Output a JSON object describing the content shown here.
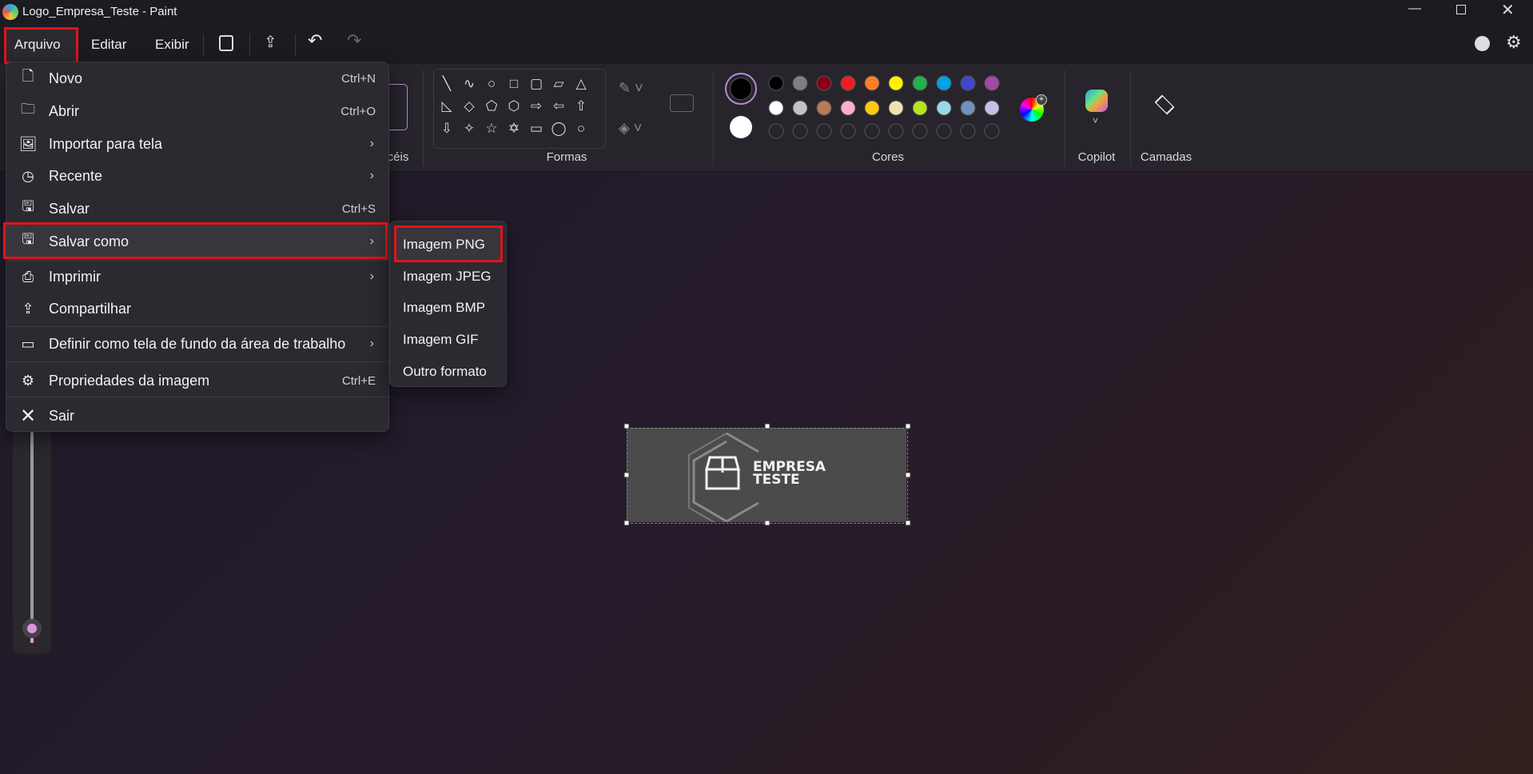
{
  "window": {
    "title": "Logo_Empresa_Teste - Paint"
  },
  "menubar": {
    "items": [
      "Arquivo",
      "Editar",
      "Exibir"
    ]
  },
  "ribbon": {
    "brushes_label_partial": "céis",
    "shapes_label": "Formas",
    "colors_label": "Cores",
    "copilot_label": "Copilot",
    "layers_label": "Camadas",
    "primary_color": "#000000",
    "secondary_color": "#ffffff",
    "palette_row1": [
      "#000000",
      "#7f7f7f",
      "#880015",
      "#ed1c24",
      "#ff7f27",
      "#fff200",
      "#22b14c",
      "#00a2e8",
      "#3f48cc",
      "#a349a4"
    ],
    "palette_row2": [
      "#ffffff",
      "#c3c3c3",
      "#b97a57",
      "#ffaec9",
      "#ffc90e",
      "#efe4b0",
      "#b5e61d",
      "#99d9ea",
      "#7092be",
      "#c8bfe7"
    ]
  },
  "file_menu": {
    "items": [
      {
        "label": "Novo",
        "shortcut": "Ctrl+N",
        "icon": "new-file-icon"
      },
      {
        "label": "Abrir",
        "shortcut": "Ctrl+O",
        "icon": "folder-icon"
      },
      {
        "label": "Importar para tela",
        "icon": "import-image-icon"
      },
      {
        "label": "Recente",
        "icon": "clock-icon"
      },
      {
        "label": "Salvar",
        "shortcut": "Ctrl+S",
        "icon": "save-icon"
      },
      {
        "label": "Salvar como",
        "icon": "save-as-icon"
      },
      {
        "label": "Imprimir",
        "icon": "printer-icon"
      },
      {
        "label": "Compartilhar",
        "icon": "share-icon"
      },
      {
        "label": "Definir como tela de fundo da área de trabalho",
        "icon": "wallpaper-icon"
      },
      {
        "label": "Propriedades da imagem",
        "shortcut": "Ctrl+E",
        "icon": "image-properties-icon"
      },
      {
        "label": "Sair",
        "icon": "close-icon"
      }
    ]
  },
  "save_as_submenu": {
    "items": [
      "Imagem PNG",
      "Imagem JPEG",
      "Imagem BMP",
      "Imagem GIF",
      "Outro formato"
    ]
  },
  "canvas": {
    "logo_line1": "EMPRESA",
    "logo_line2": "TESTE"
  },
  "zoom_slider": {
    "value": 0.0
  }
}
